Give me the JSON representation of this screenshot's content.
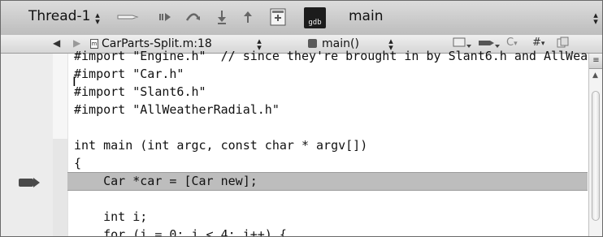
{
  "debugger_bar": {
    "thread_label": "Thread-1",
    "gdb_label": "gdb",
    "function_label": "main",
    "icons": [
      "breakpoints-toggle-icon",
      "continue-icon",
      "step-over-icon",
      "step-into-icon",
      "step-out-icon",
      "debugger-window-icon",
      "gdb-console-icon"
    ]
  },
  "nav_bar": {
    "file_label": "CarParts-Split.m:18",
    "function_label": "main()",
    "file_icon_glyph": "m",
    "tools": [
      "bookmarks-menu-icon",
      "breakpoints-menu-icon",
      "class-menu-icon",
      "pragma-menu-icon",
      "counterpart-icon"
    ],
    "tool_glyphs": {
      "class": "C",
      "pragma": "#"
    }
  },
  "editor": {
    "lines": [
      "#import \"Engine.h\"  // since they're brought in by Slant6.h and AllWea",
      "#import \"Car.h\"",
      "#import \"Slant6.h\"",
      "#import \"AllWeatherRadial.h\"",
      "",
      "int main (int argc, const char * argv[])",
      "{",
      "    Car *car = [Car new];",
      "",
      "    int i;",
      "    for (i = 0; i < 4; i++) {"
    ],
    "current_line_index": 7,
    "split_glyph": "≡"
  },
  "colors": {
    "toolbar_bg": "#cccccc",
    "highlight_bg": "#bdbdbd",
    "pc_arrow": "#4a4a4a"
  }
}
